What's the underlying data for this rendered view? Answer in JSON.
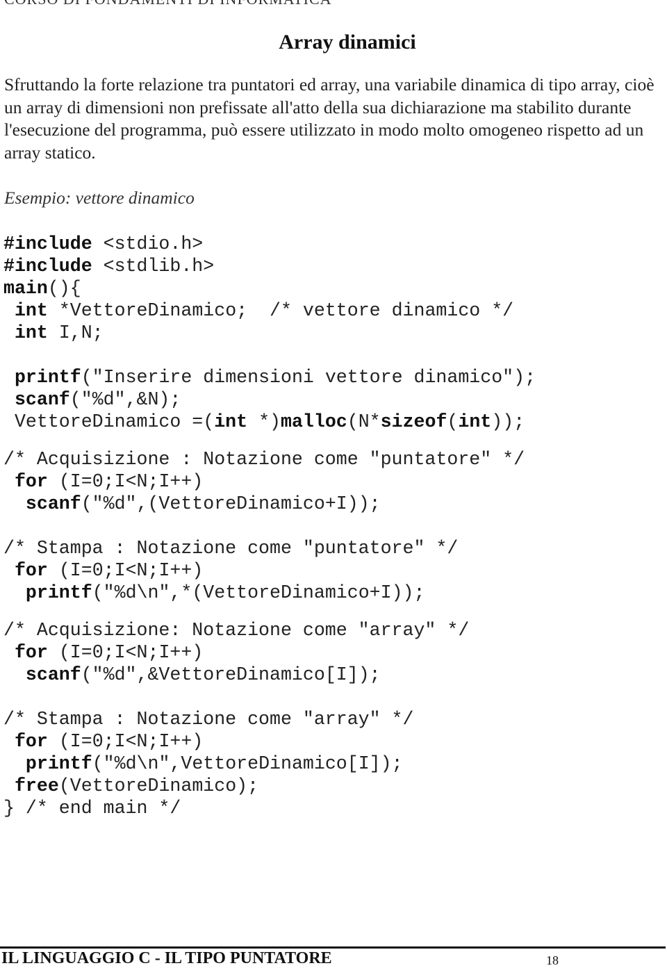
{
  "header": {
    "running_title": "CORSO DI FONDAMENTI DI INFORMATICA"
  },
  "page": {
    "title": "Array dinamici",
    "paragraph": "Sfruttando la forte relazione tra puntatori ed array, una variabile dinamica di tipo array, cioè un array di dimensioni non prefissate all'atto della sua dichiarazione ma stabilito durante l'esecuzione del programma, può essere utilizzato in modo molto omogeneo rispetto ad un array statico.",
    "example_label": "Esempio: vettore dinamico"
  },
  "code": {
    "l1": {
      "a": "#include",
      "b": " <stdio.h>"
    },
    "l2": {
      "a": "#include",
      "b": " <stdlib.h>"
    },
    "l3": {
      "a": "main",
      "b": "(){"
    },
    "l4": {
      "a": " ",
      "b": "int",
      "c": " *VettoreDinamico;  /* vettore dinamico */"
    },
    "l5": {
      "a": " ",
      "b": "int",
      "c": " I,N;"
    },
    "l6": {
      "a": " ",
      "b": "printf",
      "c": "(\"Inserire dimensioni vettore dinamico\");"
    },
    "l7": {
      "a": " ",
      "b": "scanf",
      "c": "(\"%d\",&N);"
    },
    "l8": {
      "a": " VettoreDinamico =(",
      "b": "int",
      "c": " *)",
      "d": "malloc",
      "e": "(N*",
      "f": "sizeof",
      "g": "(",
      "h": "int",
      "i": "));"
    },
    "l9": {
      "a": "/* Acquisizione : Notazione come \"puntatore\" */"
    },
    "l10": {
      "a": " ",
      "b": "for",
      "c": " (I=0;I<N;I++)"
    },
    "l11": {
      "a": "  ",
      "b": "scanf",
      "c": "(\"%d\",(VettoreDinamico+I));"
    },
    "l12": {
      "a": "/* Stampa : Notazione come \"puntatore\" */"
    },
    "l13": {
      "a": " ",
      "b": "for",
      "c": " (I=0;I<N;I++)"
    },
    "l14": {
      "a": "  ",
      "b": "printf",
      "c": "(\"%d\\n\",*(VettoreDinamico+I));"
    },
    "l15": {
      "a": "/* Acquisizione: Notazione come \"array\" */"
    },
    "l16": {
      "a": " ",
      "b": "for",
      "c": " (I=0;I<N;I++)"
    },
    "l17": {
      "a": "  ",
      "b": "scanf",
      "c": "(\"%d\",&VettoreDinamico[I]);"
    },
    "l18": {
      "a": "/* Stampa : Notazione come \"array\" */"
    },
    "l19": {
      "a": " ",
      "b": "for",
      "c": " (I=0;I<N;I++)"
    },
    "l20": {
      "a": "  ",
      "b": "printf",
      "c": "(\"%d\\n\",VettoreDinamico[I]);"
    },
    "l21": {
      "a": " ",
      "b": "free",
      "c": "(VettoreDinamico);"
    },
    "l22": {
      "a": "} /* end main */"
    }
  },
  "footer": {
    "chapter": "IL LINGUAGGIO C - IL TIPO PUNTATORE",
    "page_number": "18"
  }
}
